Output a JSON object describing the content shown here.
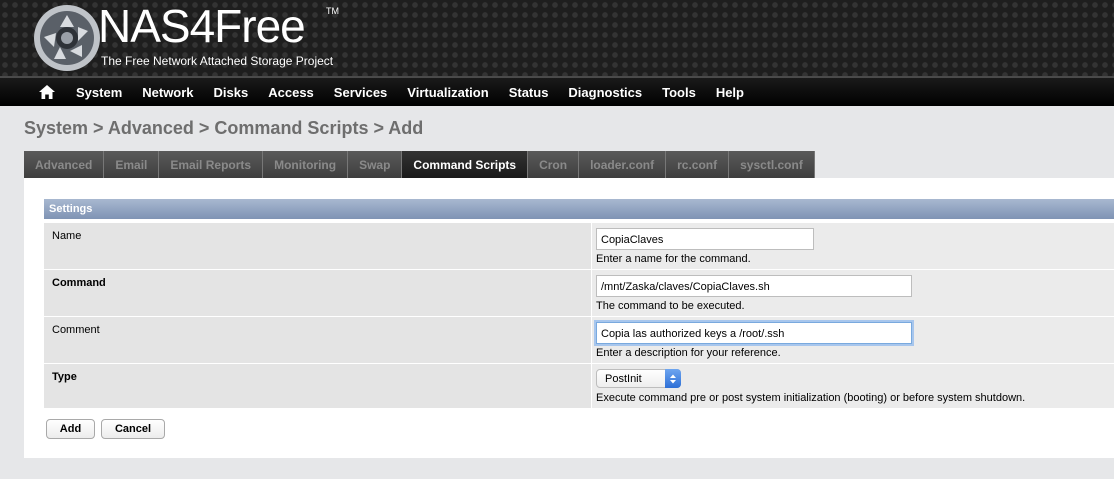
{
  "header": {
    "logo_text": "NAS4Free",
    "trademark": "TM",
    "tagline": "The Free Network Attached Storage Project"
  },
  "nav": {
    "home_icon": "home-icon",
    "items": [
      "System",
      "Network",
      "Disks",
      "Access",
      "Services",
      "Virtualization",
      "Status",
      "Diagnostics",
      "Tools",
      "Help"
    ]
  },
  "breadcrumb": "System > Advanced > Command Scripts > Add",
  "tabs": [
    {
      "label": "Advanced",
      "active": false
    },
    {
      "label": "Email",
      "active": false
    },
    {
      "label": "Email Reports",
      "active": false
    },
    {
      "label": "Monitoring",
      "active": false
    },
    {
      "label": "Swap",
      "active": false
    },
    {
      "label": "Command Scripts",
      "active": true
    },
    {
      "label": "Cron",
      "active": false
    },
    {
      "label": "loader.conf",
      "active": false
    },
    {
      "label": "rc.conf",
      "active": false
    },
    {
      "label": "sysctl.conf",
      "active": false
    }
  ],
  "settings": {
    "section_title": "Settings",
    "name": {
      "label": "Name",
      "value": "CopiaClaves",
      "hint": "Enter a name for the command."
    },
    "command": {
      "label": "Command",
      "value": "/mnt/Zaska/claves/CopiaClaves.sh",
      "hint": "The command to be executed."
    },
    "comment": {
      "label": "Comment",
      "value": "Copia las authorized keys a /root/.ssh",
      "hint": "Enter a description for your reference."
    },
    "type": {
      "label": "Type",
      "value": "PostInit",
      "hint": "Execute command pre or post system initialization (booting) or before system shutdown."
    }
  },
  "buttons": {
    "add": "Add",
    "cancel": "Cancel"
  },
  "colors": {
    "section_header": "#8fa1bf",
    "nav_bg": "#000000",
    "header_bg": "#1e1e1e"
  }
}
